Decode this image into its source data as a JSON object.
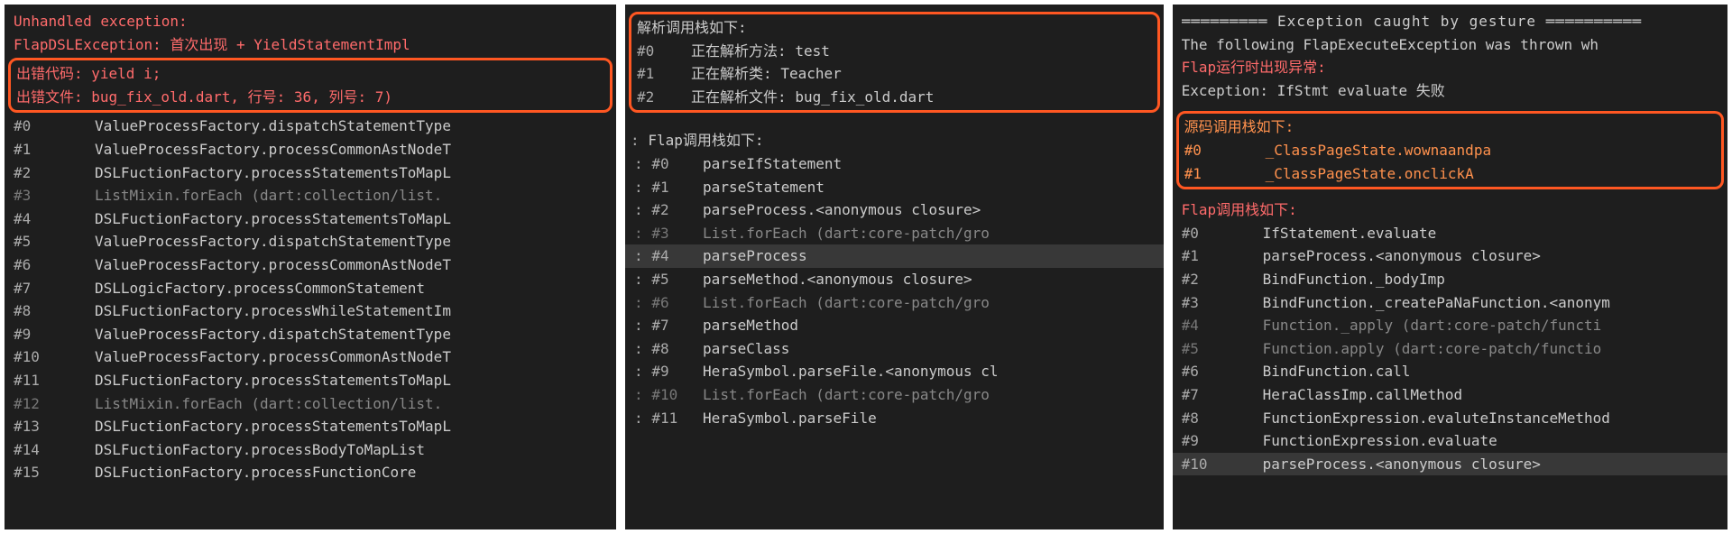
{
  "panel1": {
    "unhandled": "Unhandled exception:",
    "exception": "FlapDSLException: 首次出现 + YieldStatementImpl",
    "err_code": "出错代码: yield i;",
    "err_file": "出错文件: bug_fix_old.dart, 行号: 36, 列号: 7)",
    "frames": [
      {
        "n": "#0",
        "t": "ValueProcessFactory.dispatchStatementType",
        "dim": false
      },
      {
        "n": "#1",
        "t": "ValueProcessFactory.processCommonAstNodeT",
        "dim": false
      },
      {
        "n": "#2",
        "t": "DSLFuctionFactory.processStatementsToMapL",
        "dim": false
      },
      {
        "n": "#3",
        "t": "ListMixin.forEach  (dart:collection/list.",
        "dim": true
      },
      {
        "n": "#4",
        "t": "DSLFuctionFactory.processStatementsToMapL",
        "dim": false
      },
      {
        "n": "#5",
        "t": "ValueProcessFactory.dispatchStatementType",
        "dim": false
      },
      {
        "n": "#6",
        "t": "ValueProcessFactory.processCommonAstNodeT",
        "dim": false
      },
      {
        "n": "#7",
        "t": "DSLLogicFactory.processCommonStatement",
        "dim": false
      },
      {
        "n": "#8",
        "t": "DSLFuctionFactory.processWhileStatementIm",
        "dim": false
      },
      {
        "n": "#9",
        "t": "ValueProcessFactory.dispatchStatementType",
        "dim": false
      },
      {
        "n": "#10",
        "t": "ValueProcessFactory.processCommonAstNodeT",
        "dim": false
      },
      {
        "n": "#11",
        "t": "DSLFuctionFactory.processStatementsToMapL",
        "dim": false
      },
      {
        "n": "#12",
        "t": "ListMixin.forEach  (dart:collection/list.",
        "dim": true
      },
      {
        "n": "#13",
        "t": "DSLFuctionFactory.processStatementsToMapL",
        "dim": false
      },
      {
        "n": "#14",
        "t": "DSLFuctionFactory.processBodyToMapList",
        "dim": false
      },
      {
        "n": "#15",
        "t": "DSLFuctionFactory.processFunctionCore",
        "dim": false
      }
    ]
  },
  "panel2": {
    "parse_header": "解析调用栈如下:",
    "parse_frames": [
      {
        "n": "#0",
        "t": "正在解析方法: test"
      },
      {
        "n": "#1",
        "t": "正在解析类: Teacher"
      },
      {
        "n": "#2",
        "t": "正在解析文件: bug_fix_old.dart"
      }
    ],
    "flap_header": "Flap调用栈如下:",
    "flap_frames": [
      {
        "p": ": #0",
        "t": "parseIfStatement",
        "dim": false,
        "hl": false
      },
      {
        "p": ": #1",
        "t": "parseStatement",
        "dim": false,
        "hl": false
      },
      {
        "p": ": #2",
        "t": "parseProcess.<anonymous closure>",
        "dim": false,
        "hl": false
      },
      {
        "p": ": #3",
        "t": "List.forEach  (dart:core-patch/gro",
        "dim": true,
        "hl": false
      },
      {
        "p": ": #4",
        "t": "parseProcess",
        "dim": false,
        "hl": true
      },
      {
        "p": ": #5",
        "t": "parseMethod.<anonymous closure>",
        "dim": false,
        "hl": false
      },
      {
        "p": ": #6",
        "t": "List.forEach  (dart:core-patch/gro",
        "dim": true,
        "hl": false
      },
      {
        "p": ": #7",
        "t": "parseMethod",
        "dim": false,
        "hl": false
      },
      {
        "p": ": #8",
        "t": "parseClass",
        "dim": false,
        "hl": false
      },
      {
        "p": ": #9",
        "t": "HeraSymbol.parseFile.<anonymous cl",
        "dim": false,
        "hl": false
      },
      {
        "p": ": #10",
        "t": "List.forEach  (dart:core-patch/gro",
        "dim": true,
        "hl": false
      },
      {
        "p": ": #11",
        "t": "HeraSymbol.parseFile",
        "dim": false,
        "hl": false
      }
    ]
  },
  "panel3": {
    "header": "═════════ Exception caught by gesture ══════════",
    "thrown": "The following FlapExecuteException was thrown wh",
    "runtime_err": "Flap运行时出现异常:",
    "exception": "Exception: IfStmt evaluate 失败",
    "src_header": "源码调用栈如下:",
    "src_frames": [
      {
        "n": "#0",
        "t": "_ClassPageState.wownaandpa"
      },
      {
        "n": "#1",
        "t": "_ClassPageState.onclickA"
      }
    ],
    "flap_header": "Flap调用栈如下:",
    "flap_frames": [
      {
        "n": "#0",
        "t": "IfStatement.evaluate",
        "dim": false,
        "hl": false
      },
      {
        "n": "#1",
        "t": "parseProcess.<anonymous closure>",
        "dim": false,
        "hl": false
      },
      {
        "n": "#2",
        "t": "BindFunction._bodyImp",
        "dim": false,
        "hl": false
      },
      {
        "n": "#3",
        "t": "BindFunction._createPaNaFunction.<anonym",
        "dim": false,
        "hl": false
      },
      {
        "n": "#4",
        "t": "Function._apply  (dart:core-patch/functi",
        "dim": true,
        "hl": false
      },
      {
        "n": "#5",
        "t": "Function.apply  (dart:core-patch/functio",
        "dim": true,
        "hl": false
      },
      {
        "n": "#6",
        "t": "BindFunction.call",
        "dim": false,
        "hl": false
      },
      {
        "n": "#7",
        "t": "HeraClassImp.callMethod",
        "dim": false,
        "hl": false
      },
      {
        "n": "#8",
        "t": "FunctionExpression.evaluteInstanceMethod",
        "dim": false,
        "hl": false
      },
      {
        "n": "#9",
        "t": "FunctionExpression.evaluate",
        "dim": false,
        "hl": false
      },
      {
        "n": "#10",
        "t": "parseProcess.<anonymous closure>",
        "dim": false,
        "hl": true
      }
    ]
  }
}
